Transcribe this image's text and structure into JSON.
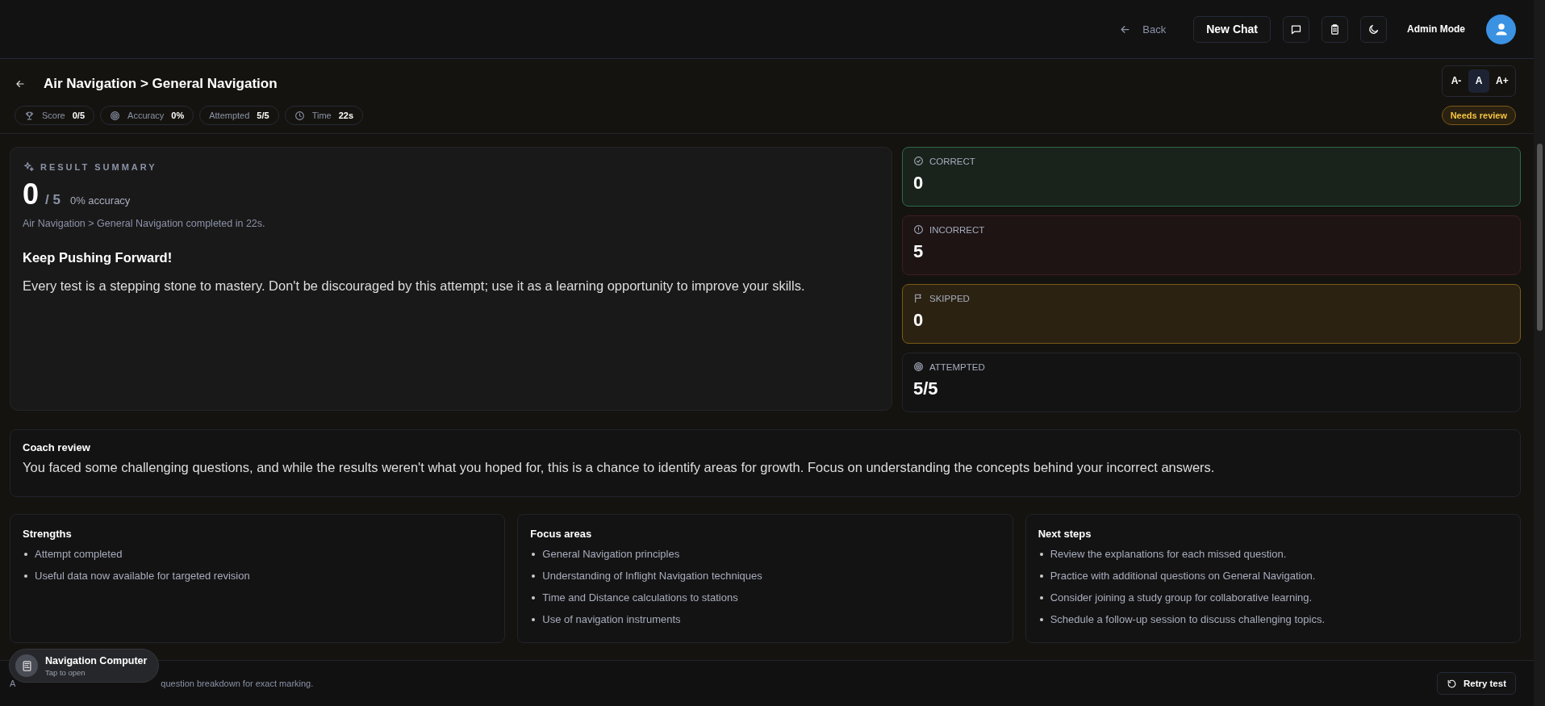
{
  "topbar": {
    "back": "Back",
    "new_chat": "New Chat",
    "mode": "Admin Mode"
  },
  "header": {
    "title": "Air Navigation > General Navigation",
    "font_sizes": [
      {
        "label": "A-",
        "selected": false
      },
      {
        "label": "A",
        "selected": true
      },
      {
        "label": "A+",
        "selected": false
      }
    ]
  },
  "stats": [
    {
      "kind": "score",
      "label": "Score",
      "value": "0/5"
    },
    {
      "kind": "accuracy",
      "label": "Accuracy",
      "value": "0%"
    },
    {
      "kind": "attempted",
      "label": "Attempted",
      "value": "5/5"
    },
    {
      "kind": "time",
      "label": "Time",
      "value": "22s"
    }
  ],
  "status_badge": "Needs review",
  "summary": {
    "heading": "RESULT SUMMARY",
    "score": "0",
    "total": "/ 5",
    "accuracy": "0% accuracy",
    "detail": "Air Navigation > General Navigation completed in 22s.",
    "title": "Keep Pushing Forward!",
    "message": "Every test is a stepping stone to mastery. Don't be discouraged by this attempt; use it as a learning opportunity to improve your skills."
  },
  "outcomes": [
    {
      "kind": "correct",
      "label": "CORRECT",
      "value": "0"
    },
    {
      "kind": "incorrect",
      "label": "INCORRECT",
      "value": "5"
    },
    {
      "kind": "skipped",
      "label": "SKIPPED",
      "value": "0"
    },
    {
      "kind": "attempted",
      "label": "ATTEMPTED",
      "value": "5/5"
    }
  ],
  "coach_review": {
    "title": "Coach review",
    "text": "You faced some challenging questions, and while the results weren't what you hoped for, this is a chance to identify areas for growth. Focus on understanding the concepts behind your incorrect answers."
  },
  "panels": [
    {
      "title": "Strengths",
      "items": [
        "Attempt completed",
        "Useful data now available for targeted revision"
      ]
    },
    {
      "title": "Focus areas",
      "items": [
        "General Navigation principles",
        "Understanding of Inflight Navigation techniques",
        "Time and Distance calculations to stations",
        "Use of navigation instruments"
      ]
    },
    {
      "title": "Next steps",
      "items": [
        "Review the explanations for each missed question.",
        "Practice with additional questions on General Navigation.",
        "Consider joining a study group for collaborative learning.",
        "Schedule a follow-up session to discuss challenging topics."
      ]
    }
  ],
  "footer": {
    "note_parts": [
      "A",
      "question breakdown for exact marking."
    ],
    "retry": "Retry test"
  },
  "toast": {
    "title": "Navigation Computer",
    "subtitle": "Tap to open"
  }
}
